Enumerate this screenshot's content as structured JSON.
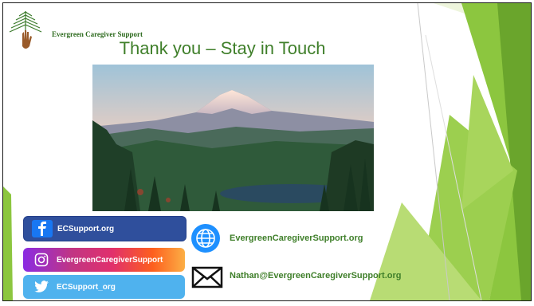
{
  "slide": {
    "logo_text": "Evergreen Caregiver Support",
    "title": "Thank you – Stay in Touch",
    "photo": "mountain-lake-landscape"
  },
  "social": {
    "facebook": {
      "label": "ECSupport.org",
      "icon": "facebook-icon"
    },
    "instagram": {
      "label": "EvergreenCaregiverSupport",
      "icon": "instagram-icon"
    },
    "twitter": {
      "label": "ECSupport_org",
      "icon": "twitter-icon"
    }
  },
  "contact": {
    "website": {
      "text": "EvergreenCaregiverSupport.org",
      "icon": "globe-icon"
    },
    "email": {
      "text": "Nathan@EvergreenCaregiverSupport.org",
      "icon": "envelope-icon"
    }
  },
  "colors": {
    "accent_green": "#3f7f2a",
    "facebook_blue": "#2f4f9c",
    "twitter_blue": "#4fb2ee",
    "globe_blue": "#1e90ff"
  }
}
